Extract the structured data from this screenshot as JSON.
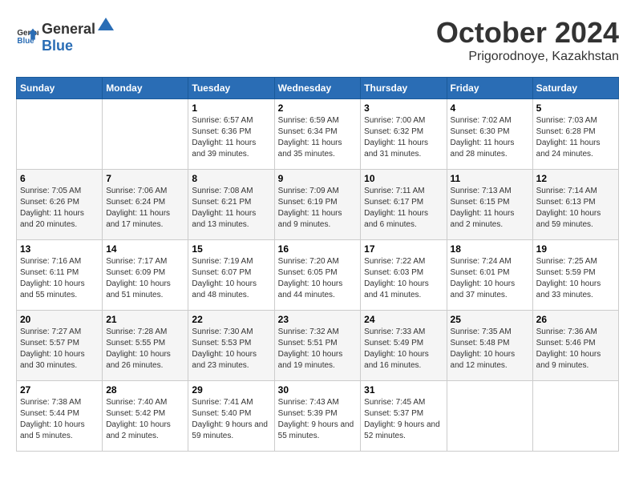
{
  "header": {
    "logo_general": "General",
    "logo_blue": "Blue",
    "month_title": "October 2024",
    "location": "Prigorodnoye, Kazakhstan"
  },
  "days_of_week": [
    "Sunday",
    "Monday",
    "Tuesday",
    "Wednesday",
    "Thursday",
    "Friday",
    "Saturday"
  ],
  "weeks": [
    [
      {
        "day": "",
        "info": ""
      },
      {
        "day": "",
        "info": ""
      },
      {
        "day": "1",
        "info": "Sunrise: 6:57 AM\nSunset: 6:36 PM\nDaylight: 11 hours and 39 minutes."
      },
      {
        "day": "2",
        "info": "Sunrise: 6:59 AM\nSunset: 6:34 PM\nDaylight: 11 hours and 35 minutes."
      },
      {
        "day": "3",
        "info": "Sunrise: 7:00 AM\nSunset: 6:32 PM\nDaylight: 11 hours and 31 minutes."
      },
      {
        "day": "4",
        "info": "Sunrise: 7:02 AM\nSunset: 6:30 PM\nDaylight: 11 hours and 28 minutes."
      },
      {
        "day": "5",
        "info": "Sunrise: 7:03 AM\nSunset: 6:28 PM\nDaylight: 11 hours and 24 minutes."
      }
    ],
    [
      {
        "day": "6",
        "info": "Sunrise: 7:05 AM\nSunset: 6:26 PM\nDaylight: 11 hours and 20 minutes."
      },
      {
        "day": "7",
        "info": "Sunrise: 7:06 AM\nSunset: 6:24 PM\nDaylight: 11 hours and 17 minutes."
      },
      {
        "day": "8",
        "info": "Sunrise: 7:08 AM\nSunset: 6:21 PM\nDaylight: 11 hours and 13 minutes."
      },
      {
        "day": "9",
        "info": "Sunrise: 7:09 AM\nSunset: 6:19 PM\nDaylight: 11 hours and 9 minutes."
      },
      {
        "day": "10",
        "info": "Sunrise: 7:11 AM\nSunset: 6:17 PM\nDaylight: 11 hours and 6 minutes."
      },
      {
        "day": "11",
        "info": "Sunrise: 7:13 AM\nSunset: 6:15 PM\nDaylight: 11 hours and 2 minutes."
      },
      {
        "day": "12",
        "info": "Sunrise: 7:14 AM\nSunset: 6:13 PM\nDaylight: 10 hours and 59 minutes."
      }
    ],
    [
      {
        "day": "13",
        "info": "Sunrise: 7:16 AM\nSunset: 6:11 PM\nDaylight: 10 hours and 55 minutes."
      },
      {
        "day": "14",
        "info": "Sunrise: 7:17 AM\nSunset: 6:09 PM\nDaylight: 10 hours and 51 minutes."
      },
      {
        "day": "15",
        "info": "Sunrise: 7:19 AM\nSunset: 6:07 PM\nDaylight: 10 hours and 48 minutes."
      },
      {
        "day": "16",
        "info": "Sunrise: 7:20 AM\nSunset: 6:05 PM\nDaylight: 10 hours and 44 minutes."
      },
      {
        "day": "17",
        "info": "Sunrise: 7:22 AM\nSunset: 6:03 PM\nDaylight: 10 hours and 41 minutes."
      },
      {
        "day": "18",
        "info": "Sunrise: 7:24 AM\nSunset: 6:01 PM\nDaylight: 10 hours and 37 minutes."
      },
      {
        "day": "19",
        "info": "Sunrise: 7:25 AM\nSunset: 5:59 PM\nDaylight: 10 hours and 33 minutes."
      }
    ],
    [
      {
        "day": "20",
        "info": "Sunrise: 7:27 AM\nSunset: 5:57 PM\nDaylight: 10 hours and 30 minutes."
      },
      {
        "day": "21",
        "info": "Sunrise: 7:28 AM\nSunset: 5:55 PM\nDaylight: 10 hours and 26 minutes."
      },
      {
        "day": "22",
        "info": "Sunrise: 7:30 AM\nSunset: 5:53 PM\nDaylight: 10 hours and 23 minutes."
      },
      {
        "day": "23",
        "info": "Sunrise: 7:32 AM\nSunset: 5:51 PM\nDaylight: 10 hours and 19 minutes."
      },
      {
        "day": "24",
        "info": "Sunrise: 7:33 AM\nSunset: 5:49 PM\nDaylight: 10 hours and 16 minutes."
      },
      {
        "day": "25",
        "info": "Sunrise: 7:35 AM\nSunset: 5:48 PM\nDaylight: 10 hours and 12 minutes."
      },
      {
        "day": "26",
        "info": "Sunrise: 7:36 AM\nSunset: 5:46 PM\nDaylight: 10 hours and 9 minutes."
      }
    ],
    [
      {
        "day": "27",
        "info": "Sunrise: 7:38 AM\nSunset: 5:44 PM\nDaylight: 10 hours and 5 minutes."
      },
      {
        "day": "28",
        "info": "Sunrise: 7:40 AM\nSunset: 5:42 PM\nDaylight: 10 hours and 2 minutes."
      },
      {
        "day": "29",
        "info": "Sunrise: 7:41 AM\nSunset: 5:40 PM\nDaylight: 9 hours and 59 minutes."
      },
      {
        "day": "30",
        "info": "Sunrise: 7:43 AM\nSunset: 5:39 PM\nDaylight: 9 hours and 55 minutes."
      },
      {
        "day": "31",
        "info": "Sunrise: 7:45 AM\nSunset: 5:37 PM\nDaylight: 9 hours and 52 minutes."
      },
      {
        "day": "",
        "info": ""
      },
      {
        "day": "",
        "info": ""
      }
    ]
  ]
}
